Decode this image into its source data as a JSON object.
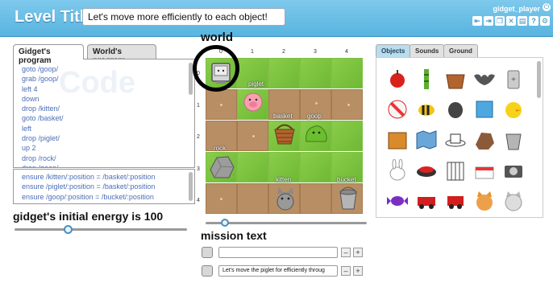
{
  "header": {
    "level_label": "Level Title",
    "level_value": "Let's move more efficiently to each object!",
    "player": "gidget_player"
  },
  "tabs": {
    "gidget": "Gidget's program",
    "world": "World's program"
  },
  "code": {
    "ghost": "Code",
    "lines": [
      "goto /goop/",
      "grab /goop/",
      "left 4",
      "down",
      "drop /kitten/",
      "goto /basket/",
      "left",
      "drop /piglet/",
      "up 2",
      "drop /rock/",
      "drop /goop/"
    ],
    "ensure": [
      "ensure /kitten/:position = /basket/:position",
      "ensure /piglet/:position = /basket/:position",
      "ensure /goop/:position = /bucket/:position"
    ]
  },
  "energy": {
    "text": "gidget's initial energy is 100",
    "level_fraction": 0.31
  },
  "world": {
    "title": "world",
    "col_numbers": [
      "0",
      "1",
      "2",
      "3",
      "4"
    ],
    "row_numbers": [
      "0",
      "1",
      "2",
      "3",
      "4"
    ],
    "labels": {
      "piglet": "piglet",
      "basket": "basket",
      "goop": "goop",
      "rock": "rock",
      "kitten": "kitten",
      "bucket": "bucket"
    },
    "slider_fraction": 0.12
  },
  "mission": {
    "title": "mission text",
    "line1": "",
    "line2": "Let's move the piglet for efficiently throug",
    "minus": "–",
    "plus": "+"
  },
  "right_tabs": [
    "Objects",
    "Sounds",
    "Ground"
  ],
  "colors": {
    "header": "#58b4e0",
    "grass": "#7fc441",
    "dirt": "#b88e64",
    "code_text": "#4b6eb8"
  }
}
